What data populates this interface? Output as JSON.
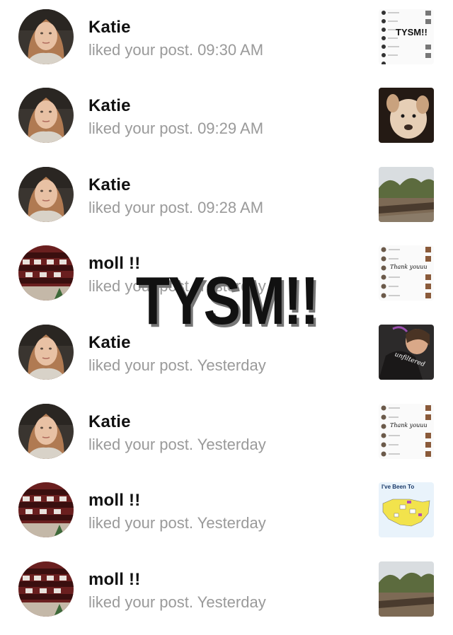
{
  "notifications": [
    {
      "user": "Katie",
      "text": "liked your post. 09:30 AM",
      "avatar": "katie-avatar",
      "thumbnail": "screenshot-list-tysm",
      "thumb_text": "TYSM!!"
    },
    {
      "user": "Katie",
      "text": "liked your post. 09:29 AM",
      "avatar": "katie-avatar",
      "thumbnail": "dog-photo"
    },
    {
      "user": "Katie",
      "text": "liked your post. 09:28 AM",
      "avatar": "katie-avatar",
      "thumbnail": "rocky-river-photo"
    },
    {
      "user": "moll !!",
      "text": "liked your post. Yesterday",
      "avatar": "moll-avatar",
      "thumbnail": "screenshot-list-thank-you",
      "thumb_text": "Thank youuu"
    },
    {
      "user": "Katie",
      "text": "liked your post. Yesterday",
      "avatar": "katie-avatar",
      "thumbnail": "selfie-photo",
      "thumb_text": "unfiltered"
    },
    {
      "user": "Katie",
      "text": "liked your post. Yesterday",
      "avatar": "katie-avatar",
      "thumbnail": "screenshot-list-thank-you",
      "thumb_text": "Thank youuu"
    },
    {
      "user": "moll !!",
      "text": "liked your post. Yesterday",
      "avatar": "moll-avatar",
      "thumbnail": "us-map",
      "thumb_text": "I've Been To"
    },
    {
      "user": "moll !!",
      "text": "liked your post. Yesterday",
      "avatar": "moll-avatar",
      "thumbnail": "rocky-river-photo"
    }
  ],
  "overlay_text": "TYSM!!",
  "colors": {
    "name": "#111111",
    "activity": "#9a9a9a",
    "background": "#ffffff"
  }
}
